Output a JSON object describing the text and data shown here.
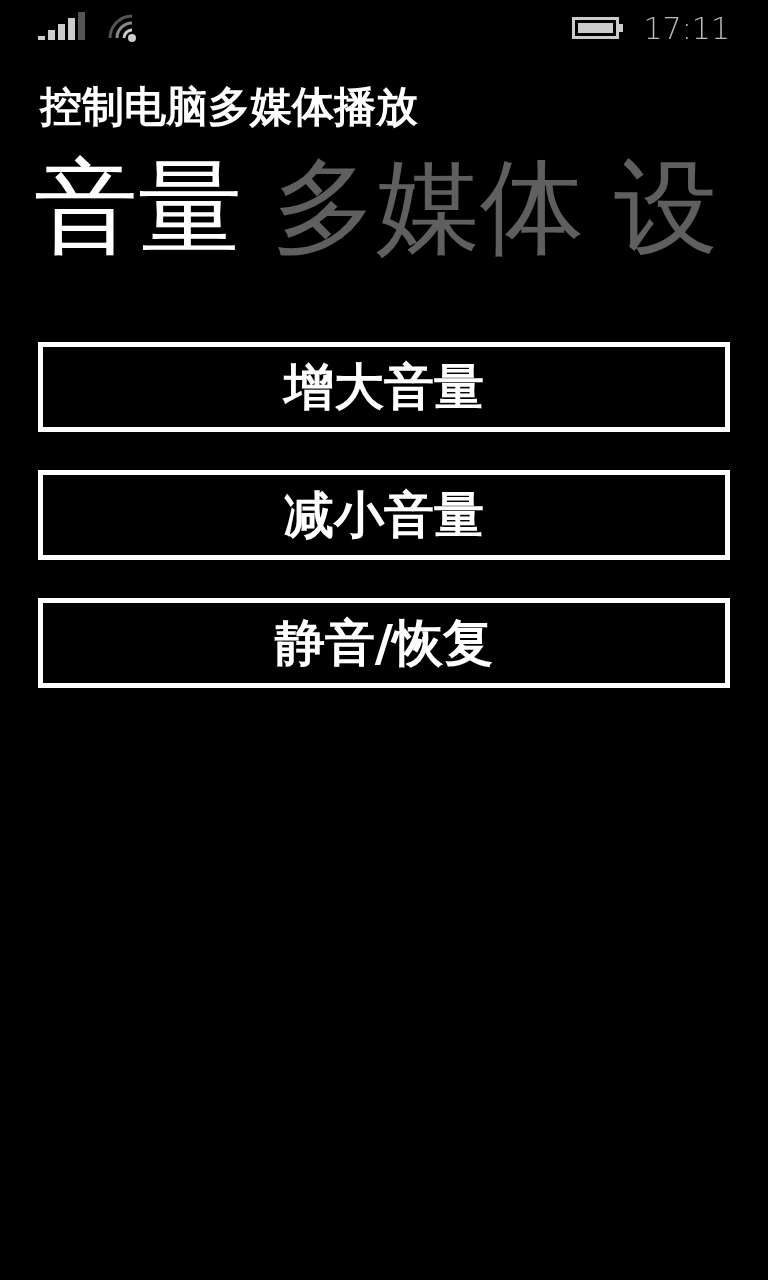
{
  "status_bar": {
    "time": "17:11"
  },
  "app_title": "控制电脑多媒体播放",
  "pivot": [
    {
      "label": "音量",
      "selected": true
    },
    {
      "label": "多媒体",
      "selected": false
    },
    {
      "label": "设",
      "selected": false
    }
  ],
  "buttons": [
    "增大音量",
    "减小音量",
    "静音/恢复"
  ]
}
